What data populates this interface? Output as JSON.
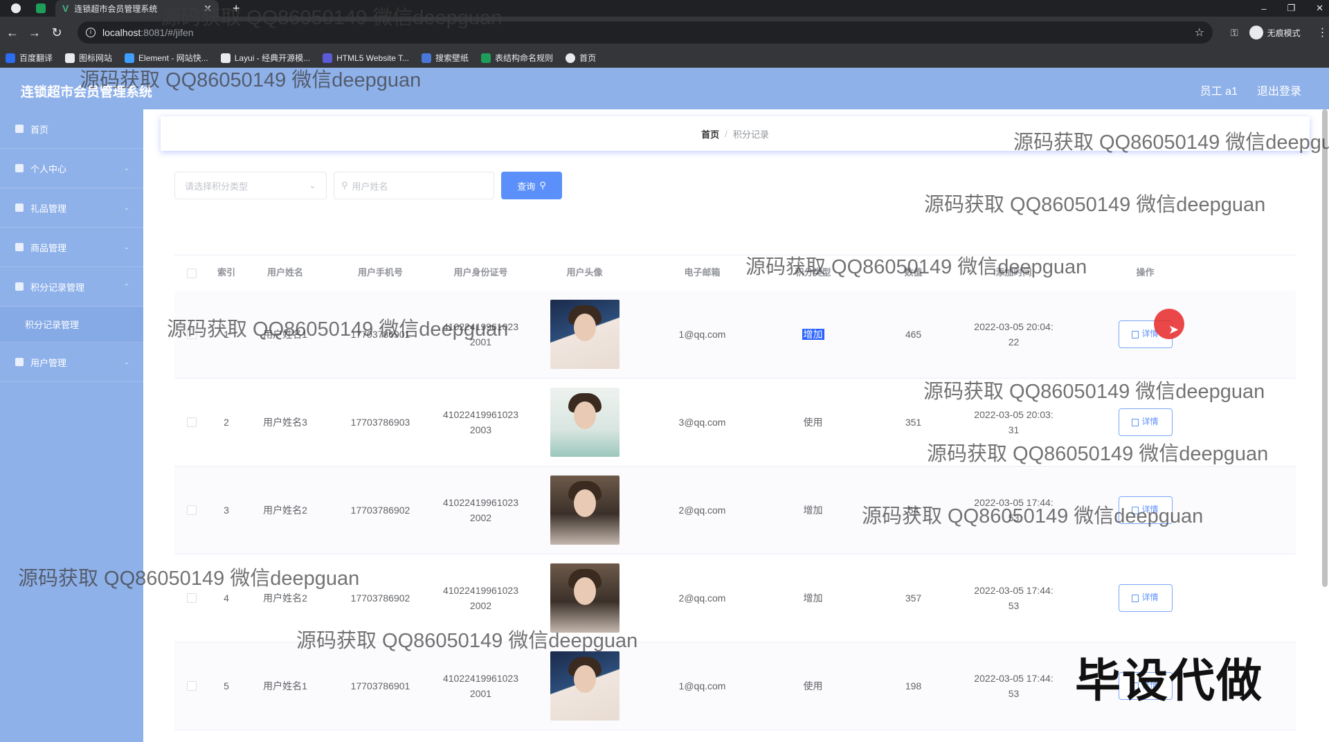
{
  "browser": {
    "tab_title": "连锁超市会员管理系统",
    "url_host": "localhost",
    "url_path": ":8081/#/jifen",
    "incognito_label": "无痕模式",
    "bookmarks": [
      {
        "label": "百度翻译",
        "color": "#2c6cf0"
      },
      {
        "label": "图标网站",
        "color": "#e8eaed"
      },
      {
        "label": "Element - 网站快...",
        "color": "#409eff"
      },
      {
        "label": "Layui - 经典开源模...",
        "color": "#e8eaed"
      },
      {
        "label": "HTML5 Website T...",
        "color": "#5b5bd6"
      },
      {
        "label": "搜索壁纸",
        "color": "#4a78d8"
      },
      {
        "label": "表结构命名规则",
        "color": "#1e9e5a"
      },
      {
        "label": "首页",
        "color": "#e8eaed"
      }
    ]
  },
  "header": {
    "title": "连锁超市会员管理系统",
    "user": "员工 a1",
    "logout": "退出登录"
  },
  "sidebar": {
    "items": [
      {
        "label": "首页"
      },
      {
        "label": "个人中心"
      },
      {
        "label": "礼品管理"
      },
      {
        "label": "商品管理"
      },
      {
        "label": "积分记录管理"
      },
      {
        "label": "积分记录管理",
        "sub": true
      },
      {
        "label": "用户管理"
      }
    ]
  },
  "breadcrumb": {
    "home": "首页",
    "sep": "/",
    "current": "积分记录"
  },
  "search": {
    "type_placeholder": "请选择积分类型",
    "name_placeholder": "用户姓名",
    "query_label": "查询"
  },
  "table": {
    "headers": [
      "索引",
      "用户姓名",
      "用户手机号",
      "用户身份证号",
      "用户头像",
      "电子邮箱",
      "积分类型",
      "数值",
      "添加时间",
      "操作"
    ],
    "detail_label": "详情",
    "rows": [
      {
        "idx": "1",
        "name": "用户姓名1",
        "phone": "17703786901",
        "id1": "41022419961023",
        "id2": "2001",
        "avatar": "boy",
        "email": "1@qq.com",
        "type": "增加",
        "highlight": true,
        "value": "465",
        "time1": "2022-03-05 20:04:",
        "time2": "22"
      },
      {
        "idx": "2",
        "name": "用户姓名3",
        "phone": "17703786903",
        "id1": "41022419961023",
        "id2": "2003",
        "avatar": "girl",
        "email": "3@qq.com",
        "type": "使用",
        "highlight": false,
        "value": "351",
        "time1": "2022-03-05 20:03:",
        "time2": "31"
      },
      {
        "idx": "3",
        "name": "用户姓名2",
        "phone": "17703786902",
        "id1": "41022419961023",
        "id2": "2002",
        "avatar": "man",
        "email": "2@qq.com",
        "type": "增加",
        "highlight": false,
        "value": "54",
        "time1": "2022-03-05 17:44:",
        "time2": "53"
      },
      {
        "idx": "4",
        "name": "用户姓名2",
        "phone": "17703786902",
        "id1": "41022419961023",
        "id2": "2002",
        "avatar": "man",
        "email": "2@qq.com",
        "type": "增加",
        "highlight": false,
        "value": "357",
        "time1": "2022-03-05 17:44:",
        "time2": "53"
      },
      {
        "idx": "5",
        "name": "用户姓名1",
        "phone": "17703786901",
        "id1": "41022419961023",
        "id2": "2001",
        "avatar": "boy",
        "email": "1@qq.com",
        "type": "使用",
        "highlight": false,
        "value": "198",
        "time1": "2022-03-05 17:44:",
        "time2": "53"
      }
    ]
  },
  "watermark": {
    "text": "源码获取 QQ86050149 微信deepguan",
    "stamp": "毕设代做"
  }
}
